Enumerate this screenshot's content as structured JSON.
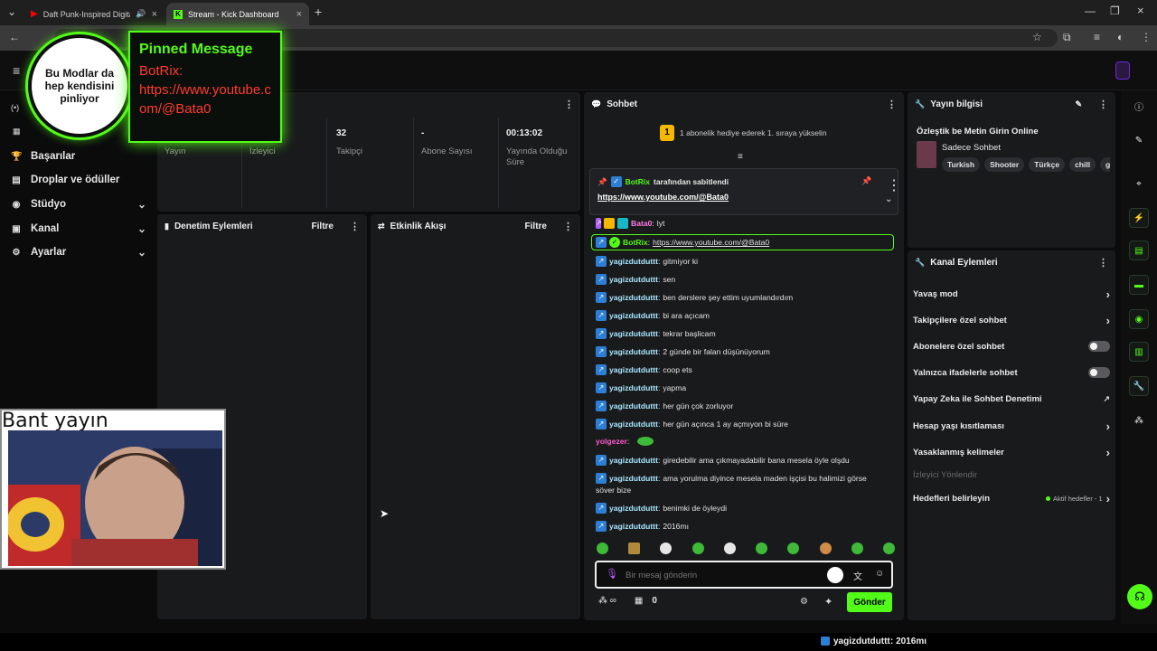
{
  "browser": {
    "tabs": [
      {
        "label": "Daft Punk-Inspired Digital"
      },
      {
        "label": "Stream - Kick Dashboard"
      }
    ]
  },
  "sidebar": {
    "items": [
      {
        "label": "Başarılar",
        "icon": "trophy-icon"
      },
      {
        "label": "Droplar ve ödüller",
        "icon": "gift-icon"
      },
      {
        "label": "Stüdyo",
        "icon": "studio-icon"
      },
      {
        "label": "Kanal",
        "icon": "channel-icon"
      },
      {
        "label": "Ayarlar",
        "icon": "gear-icon"
      }
    ]
  },
  "stats": {
    "items": [
      {
        "value": "",
        "label": "Yayın"
      },
      {
        "value": "",
        "label": "İzleyici"
      },
      {
        "value": "32",
        "label": "Takipçi"
      },
      {
        "value": "-",
        "label": "Abone Sayısı"
      },
      {
        "value": "00:13:02",
        "label": "Yayında Olduğu Süre"
      }
    ]
  },
  "moderation": {
    "title": "Denetim Eylemleri",
    "filter": "Filtre"
  },
  "activity": {
    "title": "Etkinlik Akışı",
    "filter": "Filtre"
  },
  "chat": {
    "title": "Sohbet",
    "gift_banner": "1 abonelik hediye ederek 1. sıraya yükselin",
    "gift_rank": "1",
    "pinned_by_user": "BotRix",
    "pinned_by_suffix": "tarafından sabitlendi",
    "pinned_link": "https://www.youtube.com/@Bata0",
    "messages": [
      {
        "user": "Bata0",
        "sep": ":",
        "text": "lyt",
        "style": "pink"
      },
      {
        "user": "BotRix",
        "sep": ":",
        "text": "https://www.youtube.com/@Bata0",
        "style": "green"
      },
      {
        "user": "yagizdutduttt",
        "sep": ":",
        "text": "gitmiyor ki",
        "style": "blue"
      },
      {
        "user": "yagizdutduttt",
        "sep": ":",
        "text": "sen",
        "style": "blue"
      },
      {
        "user": "yagizdutduttt",
        "sep": ":",
        "text": "ben derslere şey ettim uyumlandırdım",
        "style": "blue"
      },
      {
        "user": "yagizdutduttt",
        "sep": ":",
        "text": "bi ara açıcam",
        "style": "blue"
      },
      {
        "user": "yagizdutduttt",
        "sep": ":",
        "text": "tekrar başlicam",
        "style": "blue"
      },
      {
        "user": "yagizdutduttt",
        "sep": ":",
        "text": "2 günde bir falan düşünüyorum",
        "style": "blue"
      },
      {
        "user": "yagizdutduttt",
        "sep": ":",
        "text": "coop ets",
        "style": "blue"
      },
      {
        "user": "yagizdutduttt",
        "sep": ":",
        "text": "yapma",
        "style": "blue"
      },
      {
        "user": "yagizdutduttt",
        "sep": ":",
        "text": "her gün çok zorluyor",
        "style": "blue"
      },
      {
        "user": "yagizdutduttt",
        "sep": ":",
        "text": "her gün açınca 1 ay açmıyon bi süre",
        "style": "blue"
      },
      {
        "user": "yolgezer",
        "sep": ":",
        "text": "",
        "style": "plain"
      },
      {
        "user": "yagizdutduttt",
        "sep": ":",
        "text": "giredebilir ama çıkmayadabilir bana mesela öyle olşdu",
        "style": "blue"
      },
      {
        "user": "yagizdutduttt",
        "sep": ":",
        "text": "ama yorulma diyince mesela maden işçisi bu halimizi görse",
        "style": "blue"
      },
      {
        "user": "",
        "sep": "",
        "text": "söver bize",
        "style": "cont"
      },
      {
        "user": "yagizdutduttt",
        "sep": ":",
        "text": "benimki de öyleydi",
        "style": "blue"
      },
      {
        "user": "yagizdutduttt",
        "sep": ":",
        "text": "2016mı",
        "style": "blue"
      }
    ],
    "input_placeholder": "Bir mesaj gönderin",
    "points": "0",
    "send_label": "Gönder"
  },
  "stream_info": {
    "title": "Yayın bilgisi",
    "stream_title": "Özleştik be Metin Girin Online",
    "category": "Sadece Sohbet",
    "tags": [
      "Turkish",
      "Shooter",
      "Türkçe",
      "chill",
      "gar"
    ]
  },
  "channel_actions": {
    "title": "Kanal Eylemleri",
    "rows": [
      {
        "label": "Yavaş mod",
        "control": "chevron"
      },
      {
        "label": "Takipçilere özel sohbet",
        "control": "chevron"
      },
      {
        "label": "Abonelere özel sohbet",
        "control": "toggle"
      },
      {
        "label": "Yalnızca ifadelerle sohbet",
        "control": "toggle"
      },
      {
        "label": "Yapay Zeka ile Sohbet Denetimi",
        "control": "external"
      },
      {
        "label": "Hesap yaşı kısıtlaması",
        "control": "chevron"
      },
      {
        "label": "Yasaklanmış kelimeler",
        "control": "chevron"
      }
    ],
    "raid_label": "İzleyici Yönlendir",
    "goals_label": "Hedefleri belirleyin",
    "goals_status": "Aktif hedefler - 1"
  },
  "overlay": {
    "circle_text": "Bu Modlar da hep kendisini pinliyor",
    "pinned_title": "Pinned Message",
    "pinned_user": "BotRix:",
    "pinned_url": "https://www.youtube.com/@Bata0",
    "webcam_label": "Bant yayın"
  },
  "ticker": {
    "user": "yagizdutduttt",
    "text": ": 2016mı"
  },
  "colors": {
    "accent": "#53fc18",
    "panel": "#191a1c",
    "background": "#0b0b0c",
    "pinned_text": "#ff3b30"
  }
}
